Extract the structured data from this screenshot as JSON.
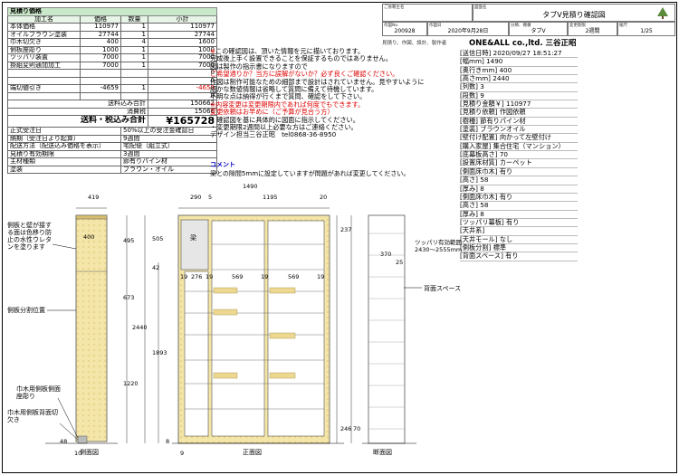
{
  "price_table": {
    "title": "見積り価格",
    "col_headers": [
      "加工名",
      "価格",
      "数量",
      "小計"
    ],
    "rows": [
      [
        "本体価格",
        "110977",
        "1",
        "110977"
      ],
      [
        "オイルブラウン塗装",
        "27744",
        "1",
        "27744"
      ],
      [
        "巾木切欠き",
        "400",
        "4",
        "1600"
      ],
      [
        "側板座彫り",
        "1000",
        "1",
        "1000"
      ],
      [
        "ツッパリ装置",
        "7000",
        "1",
        "7000"
      ],
      [
        "掛組変則通加加工",
        "7000",
        "1",
        "7000"
      ]
    ],
    "zero_value": "0",
    "discount_label": "端切値引き",
    "discount_price": "-4659",
    "discount_qty": "1",
    "discount_subtotal": "-4659",
    "discount_zero": "0",
    "shipping_label": "送料込み合計",
    "shipping_value": "150662",
    "tax_label": "消費税",
    "tax_value": "15066",
    "total_label": "送料・税込み合計",
    "total_value": "¥165728",
    "info_rows": [
      [
        "正式受注日",
        "50%以上の受注金確認日"
      ],
      [
        "納期（受注日より起算）",
        "9週間"
      ],
      [
        "配送方法（配送込み価格を表示）",
        "宅配便（組立式）"
      ],
      [
        "見積り有効期限",
        "3週間"
      ],
      [
        "主材種類",
        "節有りパイン材"
      ],
      [
        "塗装",
        "ブラウン・オイル"
      ]
    ]
  },
  "title_block": {
    "customer_label": "ご依頼主名",
    "drawing_label": "図面名",
    "drawing_name": "タブV見積り確認図",
    "work_no_label": "作図No.",
    "work_no": "200928",
    "date_label": "作図日",
    "date": "2020年9月28日",
    "category_label": "分類、棚番",
    "category": "タブV",
    "deadline_label": "変更期限",
    "deadline": "2週間",
    "scale_label": "縮尺",
    "scale": "1/25"
  },
  "header_sub": "見積り、作図、設計、製作者",
  "company": "ONE&ALL co.,ltd. 三谷正昭",
  "notes": [
    {
      "t": "※この確認図は、頂いた情報を元に描いております。",
      "c": "k",
      "first": true
    },
    {
      "t": "完成後上手く設置できることを保証するものではありません。",
      "c": "k"
    },
    {
      "t": "図は製作の指示書になりますので",
      "c": "k"
    },
    {
      "t": "ご希望通りか？当方に誤解がないか？必ず良くご確認ください。",
      "c": "r"
    },
    {
      "t": "作図は制作可能なための細部まで設計はされていません。見やすいように",
      "c": "k"
    },
    {
      "t": "細かな数値情報は省略して質問に備えて待機しています。",
      "c": "k"
    },
    {
      "t": "不明な点は納得が行くまで質問、確認をして下さい。",
      "c": "k"
    },
    {
      "t": "※内容変更は変更期限内であれば何度でもできます。",
      "c": "r"
    },
    {
      "t": "変更依頼はお早めに（ご予算が見合う方）",
      "c": "r"
    },
    {
      "t": "・確認図を基に具体的に図面に指示してください。",
      "c": "k"
    },
    {
      "t": "・変更期限2週間以上必要な方はご連絡ください。",
      "c": "k"
    },
    {
      "t": "デザイン担当三谷正昭　tel0868-36-8950",
      "c": "k"
    }
  ],
  "specs": [
    "[送信日時] 2020/09/27 18:51:27",
    "[幅mm] 1490",
    "[奥行きmm] 400",
    "[高さmm] 2440",
    "[列数] 3",
    "[段数] 9",
    "[見積り金額￥] 110977",
    "[見積り依頼] 作図依頼",
    "[樹種] 節有りパイン材",
    "[塗装] ブラウンオイル",
    "[壁付け配置] 向かって左壁付け",
    "[購入家屋] 集合住宅（マンション）",
    "[底幕板高さ] 70",
    "[設置床材質] カーペット",
    "[側面床巾木] 有り",
    "[高さ] 58",
    "[厚み] 8",
    "[側面床巾木] 有り",
    "[高さ] 58",
    "[厚み] 8",
    "[ツッパリ幕板] 有り",
    "[天井系]",
    "[天井モール] なし",
    "[側板分割] 標準",
    "[背面スペース] 有り"
  ],
  "comment_title": "コメント",
  "comment_body": "梁との隙間5mmに設定していますが問題があれば変更してください。",
  "drawing": {
    "side_view": "側面図",
    "front_view": "正面図",
    "section_view": "断面図",
    "beam": "梁",
    "back_space": "背面スペース",
    "tension_range": "ツッパリ有効範囲",
    "tension_range_value": "2430～2555mm",
    "label_side": "側板と壁が接する面は色移り防止の水性ウレタンを塗ります",
    "label_split": "側板分割位置",
    "label_baseboard": "巾木用側板側面座彫り",
    "label_cut": "巾木用側板背面切欠き",
    "dims": {
      "d419": "419",
      "d400": "400",
      "d1490": "1490",
      "d290": "290",
      "d5": "5",
      "d1195": "1195",
      "d20": "20",
      "d505": "505",
      "d495": "495",
      "d42": "42",
      "d673": "673",
      "d2440": "2440",
      "d1893": "1893",
      "d1220": "1220",
      "d19a": "19",
      "d276": "276",
      "d19b": "19",
      "d569a": "569",
      "d19c": "19",
      "d569b": "569",
      "d19d": "19",
      "d370": "370",
      "d25": "25",
      "d237": "237",
      "d246": "246",
      "d70": "70",
      "d10": "10",
      "d48": "48",
      "d9": "9",
      "d8": "8"
    }
  }
}
